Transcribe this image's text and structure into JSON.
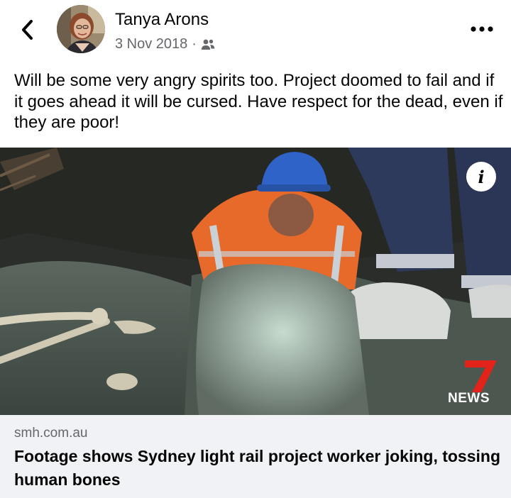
{
  "post": {
    "author": "Tanya Arons",
    "date": "3 Nov 2018",
    "separator": "·",
    "audience_icon": "friends-icon",
    "text": "Will be some very angry spirits too.  Project doomed to fail and if it goes ahead it will be cursed.  Have respect for the dead, even if they are poor!"
  },
  "header": {
    "back_icon": "chevron-left-icon",
    "more_icon": "more-horizontal-icon"
  },
  "media": {
    "info_glyph": "i",
    "broadcaster_number": "7",
    "broadcaster_label": "NEWS"
  },
  "link": {
    "domain": "smh.com.au",
    "headline": "Footage shows Sydney light rail project worker joking, tossing human bones"
  },
  "colors": {
    "secondary_text": "#65676b",
    "link_background": "#f0f2f5",
    "worker_vest": "#e86a2b",
    "hard_hat": "#2f63c8",
    "seven_red": "#e2231a"
  }
}
